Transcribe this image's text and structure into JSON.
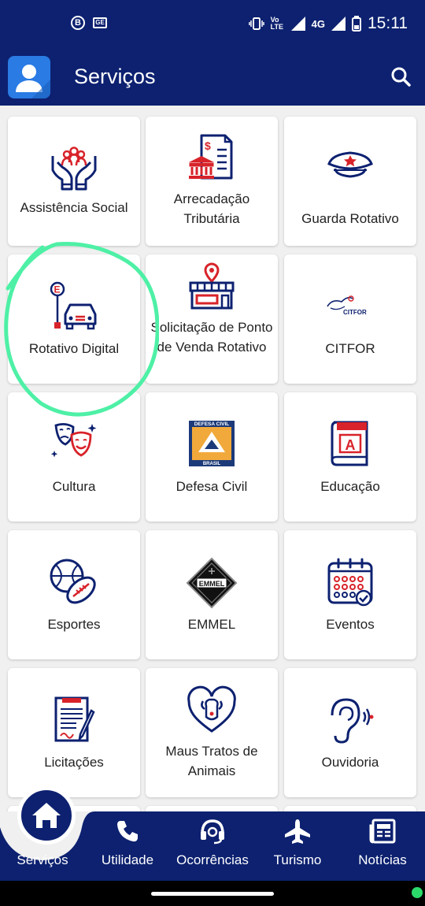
{
  "status_bar": {
    "time": "15:11",
    "network": "4G",
    "volte": "Vo LTE",
    "notif1": "B",
    "notif2": "GE"
  },
  "app_bar": {
    "title": "Serviços"
  },
  "services": [
    {
      "label": "Assistência Social",
      "icon": "hands-people-icon"
    },
    {
      "label": "Arrecadação Tributária",
      "icon": "tax-document-bank-icon"
    },
    {
      "label": "Guarda Rotativo",
      "icon": "police-cap-icon"
    },
    {
      "label": "Rotativo Digital",
      "icon": "parking-car-icon"
    },
    {
      "label": "Solicitação de Ponto de Venda Rotativo",
      "icon": "store-location-icon"
    },
    {
      "label": "CITFOR",
      "icon": "citfor-logo"
    },
    {
      "label": "Cultura",
      "icon": "theater-masks-icon"
    },
    {
      "label": "Defesa Civil",
      "icon": "defesa-civil-logo"
    },
    {
      "label": "Educação",
      "icon": "book-icon"
    },
    {
      "label": "Esportes",
      "icon": "balls-icon"
    },
    {
      "label": "EMMEL",
      "icon": "emmel-logo"
    },
    {
      "label": "Eventos",
      "icon": "calendar-icon"
    },
    {
      "label": "Licitações",
      "icon": "document-pen-icon"
    },
    {
      "label": "Maus Tratos de Animais",
      "icon": "heart-dog-icon"
    },
    {
      "label": "Ouvidoria",
      "icon": "ear-icon"
    }
  ],
  "logo_text": {
    "citfor": "CITFOR",
    "defesa_top": "DEFESA CIVIL",
    "defesa_bottom": "BRASIL",
    "emmel": "EMMEL",
    "educacao_letter": "A",
    "rotativo_letter": "E"
  },
  "bottom_nav": [
    {
      "label": "Serviços",
      "icon": "home-icon"
    },
    {
      "label": "Utilidade",
      "icon": "phone-icon"
    },
    {
      "label": "Ocorrências",
      "icon": "headset-icon"
    },
    {
      "label": "Turismo",
      "icon": "airplane-icon"
    },
    {
      "label": "Notícias",
      "icon": "newspaper-icon"
    }
  ],
  "colors": {
    "primary": "#0d2170",
    "accent_red": "#d8232a",
    "highlight": "#4ef0a6"
  }
}
